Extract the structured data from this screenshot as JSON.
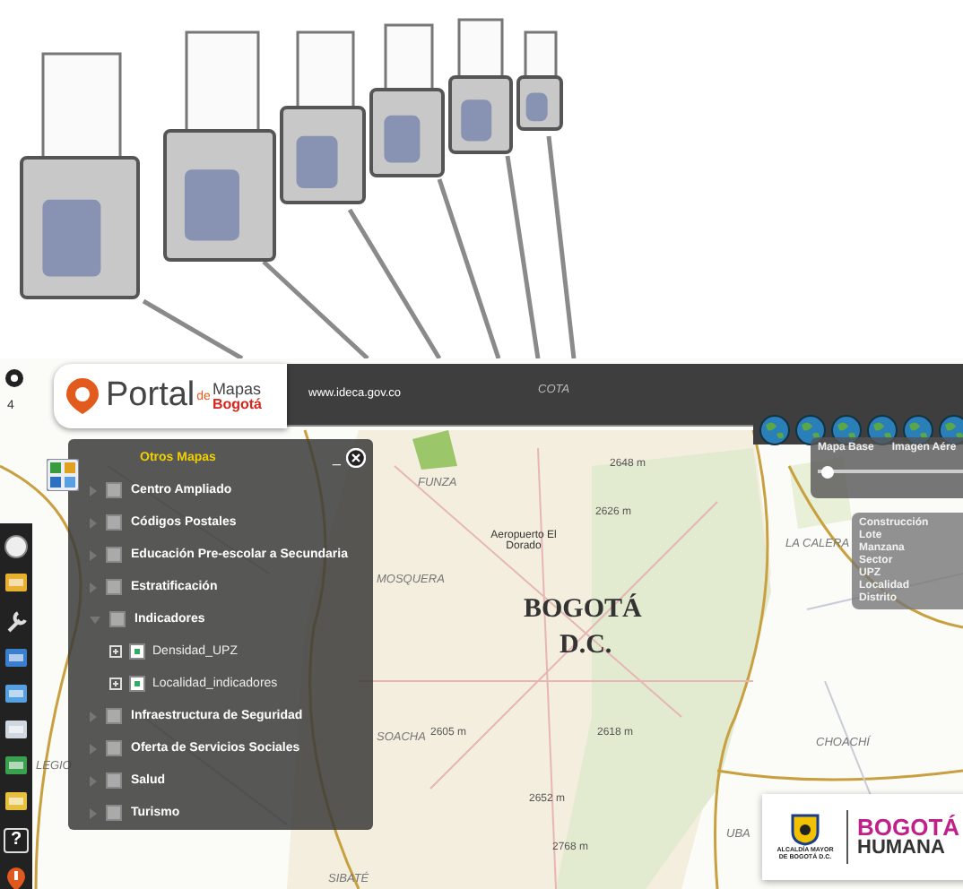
{
  "header": {
    "logo_word": "Portal",
    "logo_de": "de",
    "logo_mapas": "Mapas",
    "logo_city": "Bogotá",
    "url": "www.ideca.gov.co"
  },
  "corner_label": "4",
  "map_labels": [
    {
      "text": "COTA",
      "kind": "place"
    },
    {
      "text": "FUNZA",
      "kind": "place"
    },
    {
      "text": "2648 m",
      "kind": "height"
    },
    {
      "text": "2626 m",
      "kind": "height"
    },
    {
      "text": "Aeropuerto El Dorado",
      "kind": "poi"
    },
    {
      "text": "MOSQUERA",
      "kind": "place"
    },
    {
      "text": "BOGOTÁ",
      "kind": "capital"
    },
    {
      "text": "D.C.",
      "kind": "capital"
    },
    {
      "text": "LA CALERA",
      "kind": "place"
    },
    {
      "text": "2605 m",
      "kind": "height"
    },
    {
      "text": "2618 m",
      "kind": "height"
    },
    {
      "text": "SOACHA",
      "kind": "place"
    },
    {
      "text": "CHOACHÍ",
      "kind": "place"
    },
    {
      "text": "2652 m",
      "kind": "height"
    },
    {
      "text": "2768 m",
      "kind": "height"
    },
    {
      "text": "UBA",
      "kind": "place"
    },
    {
      "text": "SIBATÉ",
      "kind": "place"
    },
    {
      "text": "LEGIO",
      "kind": "place"
    }
  ],
  "panel": {
    "title": "Otros Mapas",
    "minimize": "_",
    "items": [
      {
        "label": "Centro Ampliado",
        "expanded": false,
        "checked": false
      },
      {
        "label": "Códigos Postales",
        "expanded": false,
        "checked": false
      },
      {
        "label": "Educación Pre-escolar a Secundaria",
        "expanded": false,
        "checked": false
      },
      {
        "label": "Estratificación",
        "expanded": false,
        "checked": false
      },
      {
        "label": "Indicadores",
        "expanded": true,
        "checked": false,
        "children": [
          {
            "label": "Densidad_UPZ",
            "checked": true
          },
          {
            "label": "Localidad_indicadores",
            "checked": true
          }
        ]
      },
      {
        "label": "Infraestructura de Seguridad",
        "expanded": false,
        "checked": false
      },
      {
        "label": "Oferta de Servicios Sociales",
        "expanded": false,
        "checked": false
      },
      {
        "label": "Salud",
        "expanded": false,
        "checked": false
      },
      {
        "label": "Turismo",
        "expanded": false,
        "checked": false
      }
    ]
  },
  "basemap": {
    "options": [
      "Mapa Base",
      "Imagen Aére"
    ],
    "level": 0.05
  },
  "scale_layers": [
    "Construcción",
    "Lote",
    "Manzana",
    "Sector",
    "UPZ",
    "Localidad",
    "Distrito"
  ],
  "help_button": "?",
  "footer_logo": {
    "city_seal": "ALCALDÍA MAYOR DE BOGOTÁ D.C.",
    "brand_top": "BOGOTÁ",
    "brand_bottom": "HUMANA"
  }
}
